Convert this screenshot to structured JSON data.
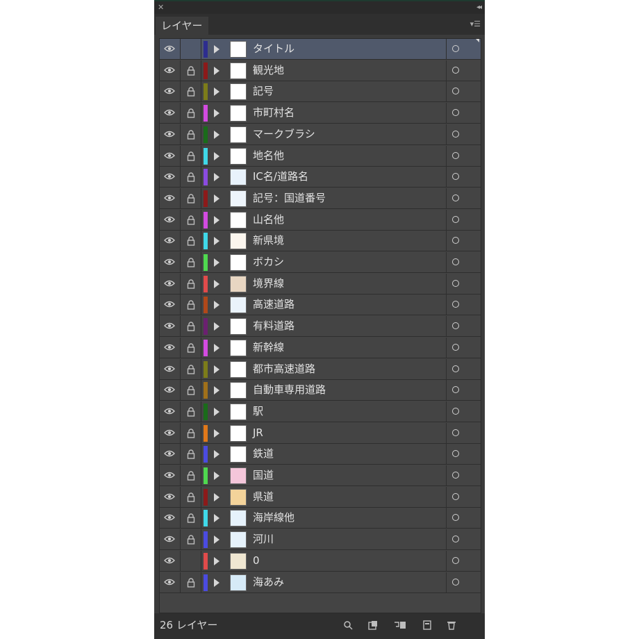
{
  "panel": {
    "tab_label": "レイヤー",
    "layer_count_label": "26 レイヤー"
  },
  "layers": [
    {
      "name": "タイトル",
      "color": "#2d2d8f",
      "locked": false,
      "selected": true,
      "thumb": "#ffffff"
    },
    {
      "name": "観光地",
      "color": "#8c1a1a",
      "locked": true,
      "selected": false,
      "thumb": "#ffffff"
    },
    {
      "name": "記号",
      "color": "#7c7c1a",
      "locked": true,
      "selected": false,
      "thumb": "#ffffff"
    },
    {
      "name": "市町村名",
      "color": "#d24be0",
      "locked": true,
      "selected": false,
      "thumb": "#ffffff"
    },
    {
      "name": "マークブラシ",
      "color": "#1a6b1a",
      "locked": true,
      "selected": false,
      "thumb": "#ffffff"
    },
    {
      "name": "地名他",
      "color": "#3fd8e8",
      "locked": true,
      "selected": false,
      "thumb": "#ffffff"
    },
    {
      "name": "IC名/道路名",
      "color": "#8a4be0",
      "locked": true,
      "selected": false,
      "thumb": "#e8f2fb"
    },
    {
      "name": "記号：国道番号",
      "color": "#8c1a1a",
      "locked": true,
      "selected": false,
      "thumb": "#eef5fb"
    },
    {
      "name": "山名他",
      "color": "#d24be0",
      "locked": true,
      "selected": false,
      "thumb": "#ffffff"
    },
    {
      "name": "新県境",
      "color": "#3fd8e8",
      "locked": true,
      "selected": false,
      "thumb": "#fbf6ee"
    },
    {
      "name": "ボカシ",
      "color": "#4fd84f",
      "locked": true,
      "selected": false,
      "thumb": "#ffffff"
    },
    {
      "name": "境界線",
      "color": "#e04b4b",
      "locked": true,
      "selected": false,
      "thumb": "#e8d6c2"
    },
    {
      "name": "高速道路",
      "color": "#b0481a",
      "locked": true,
      "selected": false,
      "thumb": "#eaf3fb"
    },
    {
      "name": "有料道路",
      "color": "#6b2070",
      "locked": true,
      "selected": false,
      "thumb": "#ffffff"
    },
    {
      "name": "新幹線",
      "color": "#d24be0",
      "locked": true,
      "selected": false,
      "thumb": "#ffffff"
    },
    {
      "name": "都市高速道路",
      "color": "#7c7c1a",
      "locked": true,
      "selected": false,
      "thumb": "#ffffff"
    },
    {
      "name": "自動車専用道路",
      "color": "#a0701a",
      "locked": true,
      "selected": false,
      "thumb": "#ffffff"
    },
    {
      "name": "駅",
      "color": "#1a6b1a",
      "locked": true,
      "selected": false,
      "thumb": "#ffffff"
    },
    {
      "name": "JR",
      "color": "#e0781a",
      "locked": true,
      "selected": false,
      "thumb": "#ffffff"
    },
    {
      "name": "鉄道",
      "color": "#4b4be0",
      "locked": true,
      "selected": false,
      "thumb": "#ffffff"
    },
    {
      "name": "国道",
      "color": "#4fd84f",
      "locked": true,
      "selected": false,
      "thumb": "#f4c6da"
    },
    {
      "name": "県道",
      "color": "#8c1a1a",
      "locked": true,
      "selected": false,
      "thumb": "#f3d39a"
    },
    {
      "name": "海岸線他",
      "color": "#3fd8e8",
      "locked": true,
      "selected": false,
      "thumb": "#e6f2fb"
    },
    {
      "name": "河川",
      "color": "#4b4be0",
      "locked": true,
      "selected": false,
      "thumb": "#e6f2fb"
    },
    {
      "name": "0",
      "color": "#e04b4b",
      "locked": false,
      "selected": false,
      "thumb": "#f0e7d2"
    },
    {
      "name": "海あみ",
      "color": "#4b4be0",
      "locked": true,
      "selected": false,
      "thumb": "#d6eaf7"
    }
  ],
  "icons": {
    "visibility": "eye-icon",
    "lock": "lock-icon",
    "expand": "disclosure-triangle-icon",
    "target": "target-circle-icon",
    "bottom": [
      "search-icon",
      "make-clipping-mask-icon",
      "new-sublayer-icon",
      "new-layer-icon",
      "trash-icon"
    ]
  }
}
